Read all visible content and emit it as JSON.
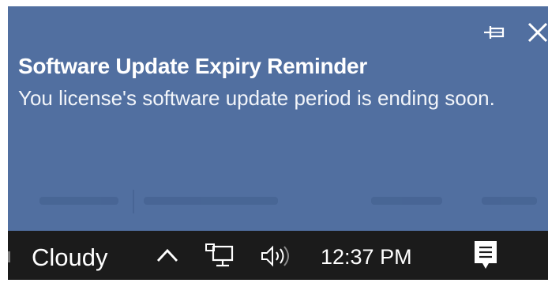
{
  "notification": {
    "title": "Software Update Expiry Reminder",
    "body": "You license's software update period is ending soon.",
    "pin_icon": "pin-icon",
    "close_icon": "close-icon",
    "background_color": "#516fa0"
  },
  "taskbar": {
    "weather_text": "Cloudy",
    "clock_time": "12:37 PM",
    "tray_icons": [
      "chevron-up-icon",
      "network-icon",
      "volume-icon",
      "action-center-icon"
    ],
    "background_color": "#1b1b1b"
  }
}
